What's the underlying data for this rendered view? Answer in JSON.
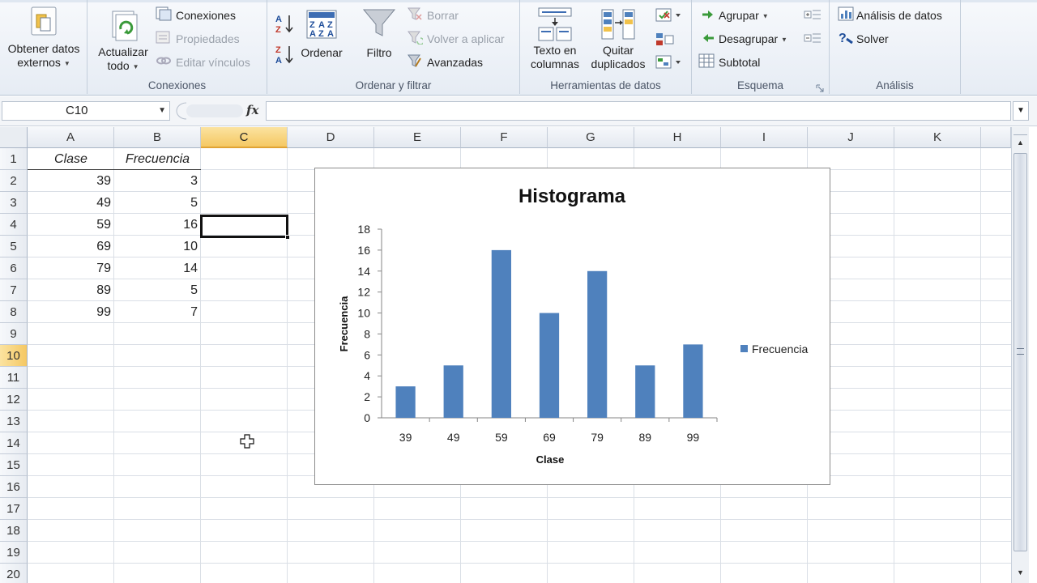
{
  "ribbon": {
    "get_external": {
      "line1": "Obtener datos",
      "line2": "externos"
    },
    "connections_group": {
      "refresh": {
        "line1": "Actualizar",
        "line2": "todo"
      },
      "connections": "Conexiones",
      "properties": "Propiedades",
      "edit_links": "Editar vínculos",
      "label": "Conexiones"
    },
    "sort_group": {
      "sort": "Ordenar",
      "filter": "Filtro",
      "clear": "Borrar",
      "reapply": "Volver a aplicar",
      "advanced": "Avanzadas",
      "label": "Ordenar y filtrar"
    },
    "tools_group": {
      "text_to_columns": {
        "line1": "Texto en",
        "line2": "columnas"
      },
      "remove_duplicates": {
        "line1": "Quitar",
        "line2": "duplicados"
      },
      "label": "Herramientas de datos"
    },
    "outline_group": {
      "group": "Agrupar",
      "ungroup": "Desagrupar",
      "subtotal": "Subtotal",
      "label": "Esquema"
    },
    "analysis_group": {
      "data_analysis": "Análisis de datos",
      "solver": "Solver",
      "label": "Análisis"
    }
  },
  "formula_bar": {
    "name_box": "C10",
    "fx": "fx",
    "formula": ""
  },
  "sheet": {
    "columns": [
      "A",
      "B",
      "C",
      "D",
      "E",
      "F",
      "G",
      "H",
      "I",
      "J",
      "K"
    ],
    "active_column": "C",
    "rows": [
      "1",
      "2",
      "3",
      "4",
      "5",
      "6",
      "7",
      "8",
      "9",
      "10",
      "11",
      "12",
      "13",
      "14",
      "15",
      "16",
      "17",
      "18",
      "19",
      "20"
    ],
    "active_row": "10",
    "header_a": "Clase",
    "header_b": "Frecuencia",
    "data": [
      [
        "39",
        "3"
      ],
      [
        "49",
        "5"
      ],
      [
        "59",
        "16"
      ],
      [
        "69",
        "10"
      ],
      [
        "79",
        "14"
      ],
      [
        "89",
        "5"
      ],
      [
        "99",
        "7"
      ]
    ]
  },
  "chart_data": {
    "type": "bar",
    "title": "Histograma",
    "xlabel": "Clase",
    "ylabel": "Frecuencia",
    "categories": [
      "39",
      "49",
      "59",
      "69",
      "79",
      "89",
      "99"
    ],
    "series": [
      {
        "name": "Frecuencia",
        "values": [
          3,
          5,
          16,
          10,
          14,
          5,
          7
        ],
        "color": "#4f81bd"
      }
    ],
    "ylim": [
      0,
      18
    ],
    "yticks": [
      0,
      2,
      4,
      6,
      8,
      10,
      12,
      14,
      16,
      18
    ],
    "grid": false,
    "legend": "right"
  }
}
